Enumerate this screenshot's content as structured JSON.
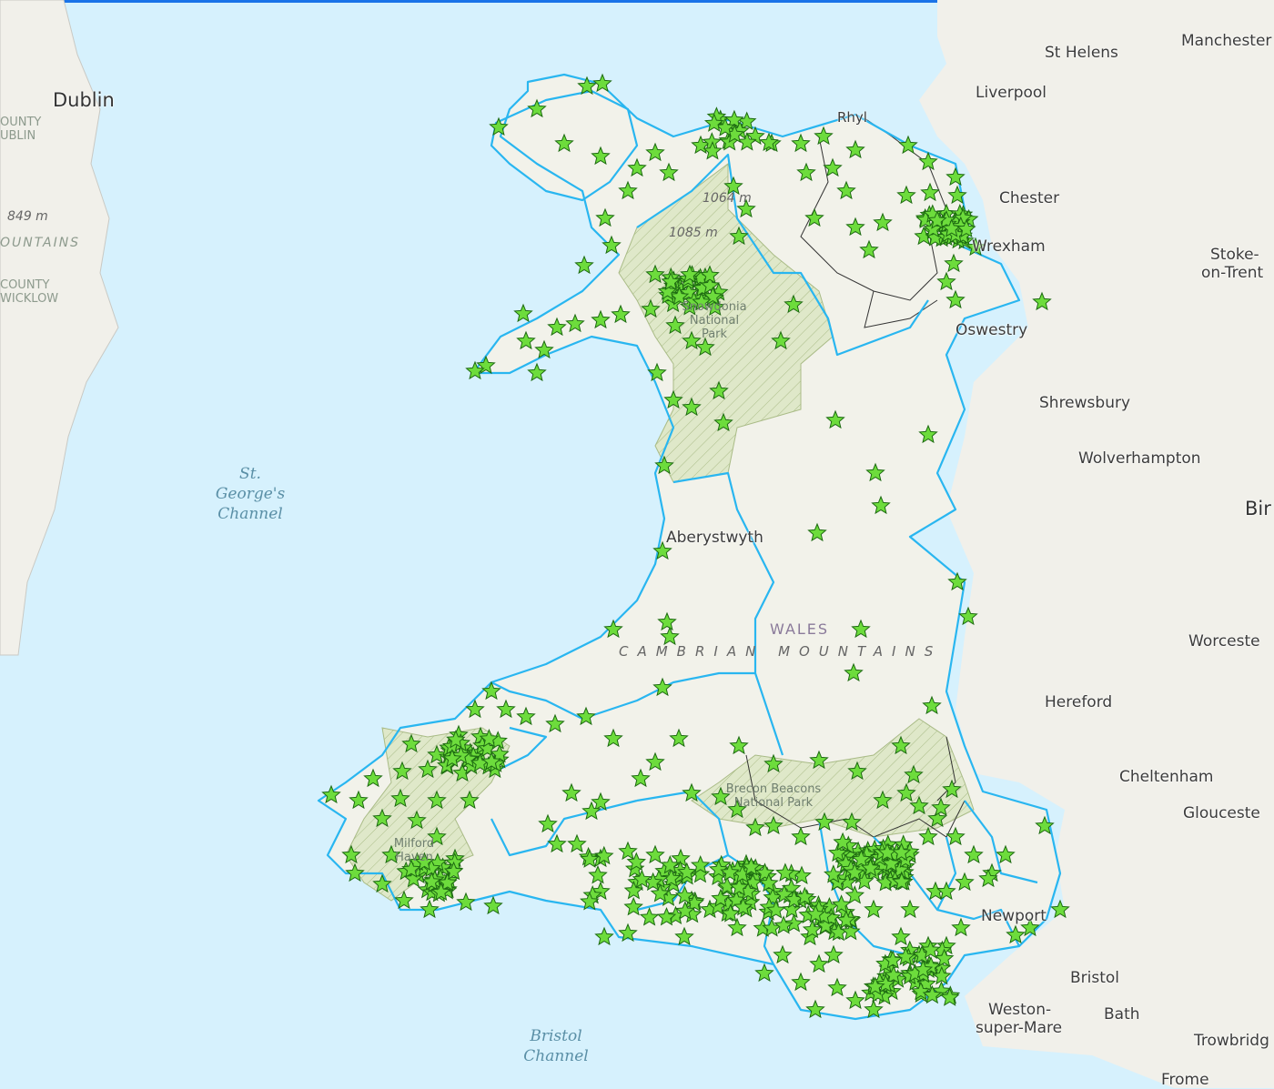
{
  "map": {
    "colors": {
      "sea": "#d6f1fd",
      "land": "#f0f0e8",
      "park_fill": "#dfe8c9",
      "boundary": "#29b6f0",
      "marker": "#6ddc3c",
      "marker_stroke": "#1e6b12"
    },
    "marker_icon": "star-marker-icon",
    "labels": {
      "dublin": "Dublin",
      "st_helens": "St Helens",
      "manchester": "Manchester",
      "liverpool": "Liverpool",
      "chester": "Chester",
      "wrexham": "Wrexham",
      "stoke_1": "Stoke-",
      "stoke_2": "on-Trent",
      "oswestry": "Oswestry",
      "shrewsbury": "Shrewsbury",
      "wolverhampton": "Wolverhampton",
      "birmingham": "Bir",
      "worcester": "Worceste",
      "hereford": "Hereford",
      "cheltenham": "Cheltenham",
      "gloucester": "Glouceste",
      "newport": "Newport",
      "bristol": "Bristol",
      "bath": "Bath",
      "weston_1": "Weston-",
      "weston_2": "super-Mare",
      "trowbridge": "Trowbridg",
      "frome": "Frome",
      "aberystwyth": "Aberystwyth",
      "rhyl": "Rhyl",
      "wales": "WALES",
      "cambrian_mountains": "CAMBRIAN MOUNTAINS",
      "snowdonia_1": "Snowdonia",
      "snowdonia_2": "National",
      "snowdonia_3": "Park",
      "brecon_1": "Brecon Beacons",
      "brecon_2": "National Park",
      "milford_1": "Milford",
      "milford_2": "Haven",
      "elev_1064": "1064 m",
      "elev_1085": "1085 m",
      "elev_849": "849 m",
      "mountains_ie": "OUNTAINS",
      "county_dublin_1": "OUNTY",
      "county_dublin_2": "UBLIN",
      "county_wicklow_1": "COUNTY",
      "county_wicklow_2": "WICKLOW",
      "st_georges_1": "St.",
      "st_georges_2": "George's",
      "st_georges_3": "Channel",
      "bristol_channel_1": "Bristol",
      "bristol_channel_2": "Channel"
    }
  }
}
